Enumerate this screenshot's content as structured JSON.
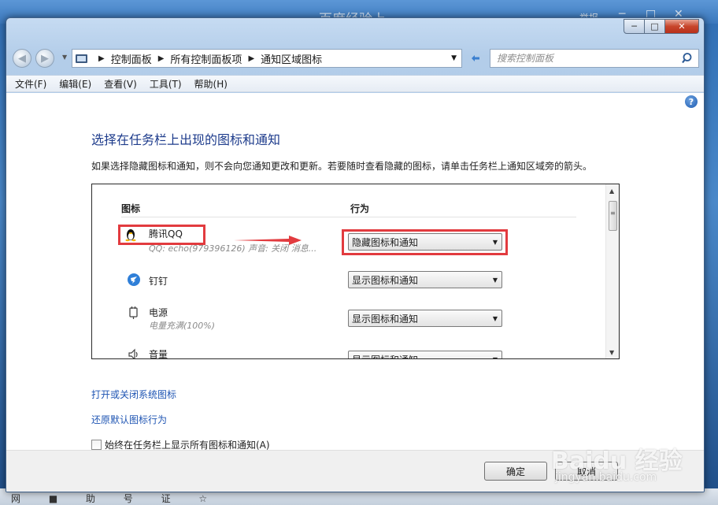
{
  "background": {
    "title": "百度经验上",
    "report": "举报",
    "taskbar_icons": "网 ■ 助 号 证 ☆"
  },
  "window": {
    "controls": {
      "minimize": "─",
      "maximize": "□",
      "close": "✕"
    }
  },
  "nav": {
    "back": "◀",
    "forward": "▶",
    "breadcrumbs": [
      "控制面板",
      "所有控制面板项",
      "通知区域图标"
    ],
    "search_placeholder": "搜索控制面板"
  },
  "menu": [
    "文件(F)",
    "编辑(E)",
    "查看(V)",
    "工具(T)",
    "帮助(H)"
  ],
  "content": {
    "help": "?",
    "title": "选择在任务栏上出现的图标和通知",
    "description": "如果选择隐藏图标和通知，则不会向您通知更改和更新。若要随时查看隐藏的图标，请单击任务栏上通知区域旁的箭头。",
    "columns": {
      "icon": "图标",
      "behavior": "行为"
    },
    "rows": [
      {
        "name": "腾讯QQ",
        "desc": "QQ: echo(979396126)  声音: 关闭  消息...",
        "behavior": "隐藏图标和通知"
      },
      {
        "name": "钉钉",
        "desc": "",
        "behavior": "显示图标和通知"
      },
      {
        "name": "电源",
        "desc": "电量充满(100%)",
        "behavior": "显示图标和通知"
      },
      {
        "name": "音量",
        "desc": "",
        "behavior": "显示图标和通知"
      }
    ],
    "link_system_icons": "打开或关闭系统图标",
    "link_restore": "还原默认图标行为",
    "checkbox_label": "始终在任务栏上显示所有图标和通知(A)"
  },
  "footer": {
    "ok": "确定",
    "cancel": "取消"
  },
  "watermark": {
    "brand": "Baidu 经验",
    "url": "jingyan.baidu.com"
  },
  "colors": {
    "link": "#1f55b3",
    "title": "#1e3c8c",
    "highlight": "#e23b3f"
  }
}
